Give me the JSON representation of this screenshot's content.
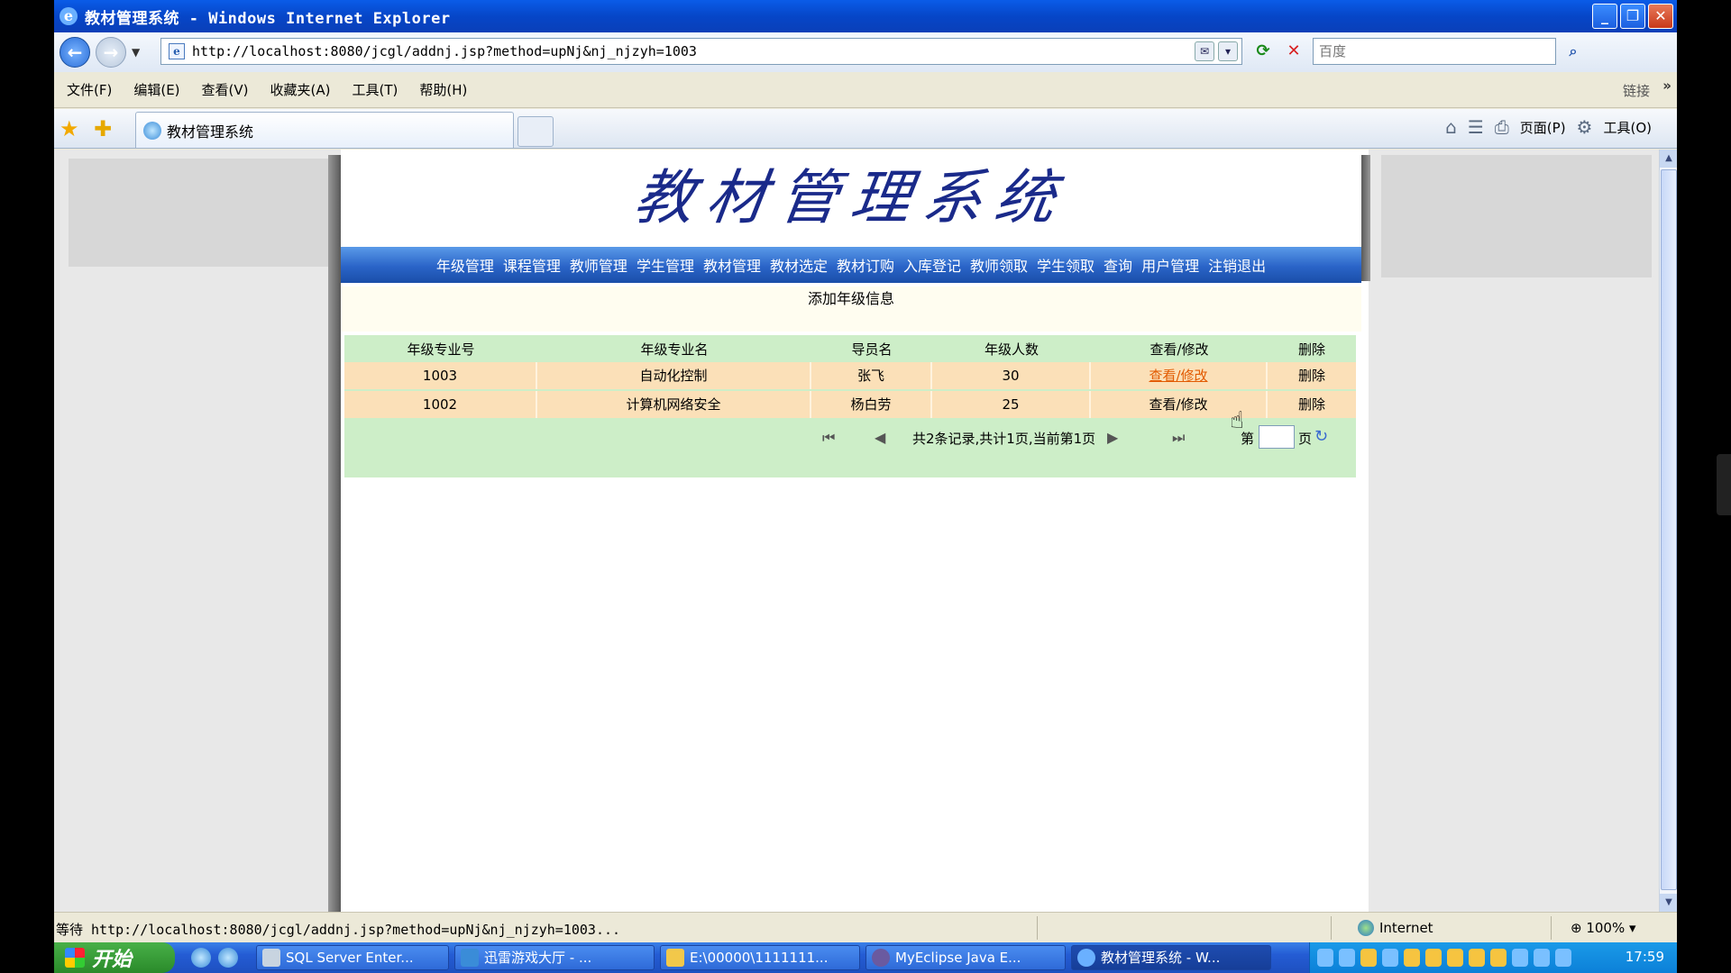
{
  "window": {
    "title": "教材管理系统 - Windows Internet Explorer"
  },
  "address": {
    "url": "http://localhost:8080/jcgl/addnj.jsp?method=upNj&nj_njzyh=1003",
    "search_placeholder": "百度"
  },
  "menu": {
    "items": [
      "文件(F)",
      "编辑(E)",
      "查看(V)",
      "收藏夹(A)",
      "工具(T)",
      "帮助(H)"
    ],
    "links_label": "链接"
  },
  "tabbar": {
    "tab_title": "教材管理系统",
    "page_label": "页面(P)",
    "tools_label": "工具(O)"
  },
  "site": {
    "logo_text": "教材管理系统",
    "nav": [
      "年级管理",
      "课程管理",
      "教师管理",
      "学生管理",
      "教材管理",
      "教材选定",
      "教材订购",
      "入库登记",
      "教师领取",
      "学生领取",
      "查询",
      "用户管理",
      "注销退出"
    ],
    "add_link": "添加年级信息"
  },
  "table": {
    "headers": [
      "年级专业号",
      "年级专业名",
      "导员名",
      "年级人数",
      "查看/修改",
      "删除"
    ],
    "rows": [
      {
        "id": "1003",
        "name": "自动化控制",
        "advisor": "张飞",
        "count": "30",
        "view": "查看/修改",
        "delete": "删除"
      },
      {
        "id": "1002",
        "name": "计算机网络安全",
        "advisor": "杨白劳",
        "count": "25",
        "view": "查看/修改",
        "delete": "删除"
      }
    ]
  },
  "pager": {
    "summary": "共2条记录,共计1页,当前第1页",
    "page_prefix": "第",
    "page_suffix": "页"
  },
  "status": {
    "text": "等待 http://localhost:8080/jcgl/addnj.jsp?method=upNj&nj_njzyh=1003...",
    "zone": "Internet",
    "zoom": "100%"
  },
  "taskbar": {
    "start": "开始",
    "tasks": [
      "SQL Server Enter...",
      "迅雷游戏大厅 - ...",
      "E:\\00000\\1111111...",
      "MyEclipse Java E...",
      "教材管理系统 - W..."
    ],
    "clock": "17:59"
  },
  "colors": {
    "nav_blue": "#2a64c8",
    "row_orange": "#fbe0b8",
    "grid_green": "#cdeec8",
    "link_orange": "#e25a00"
  }
}
